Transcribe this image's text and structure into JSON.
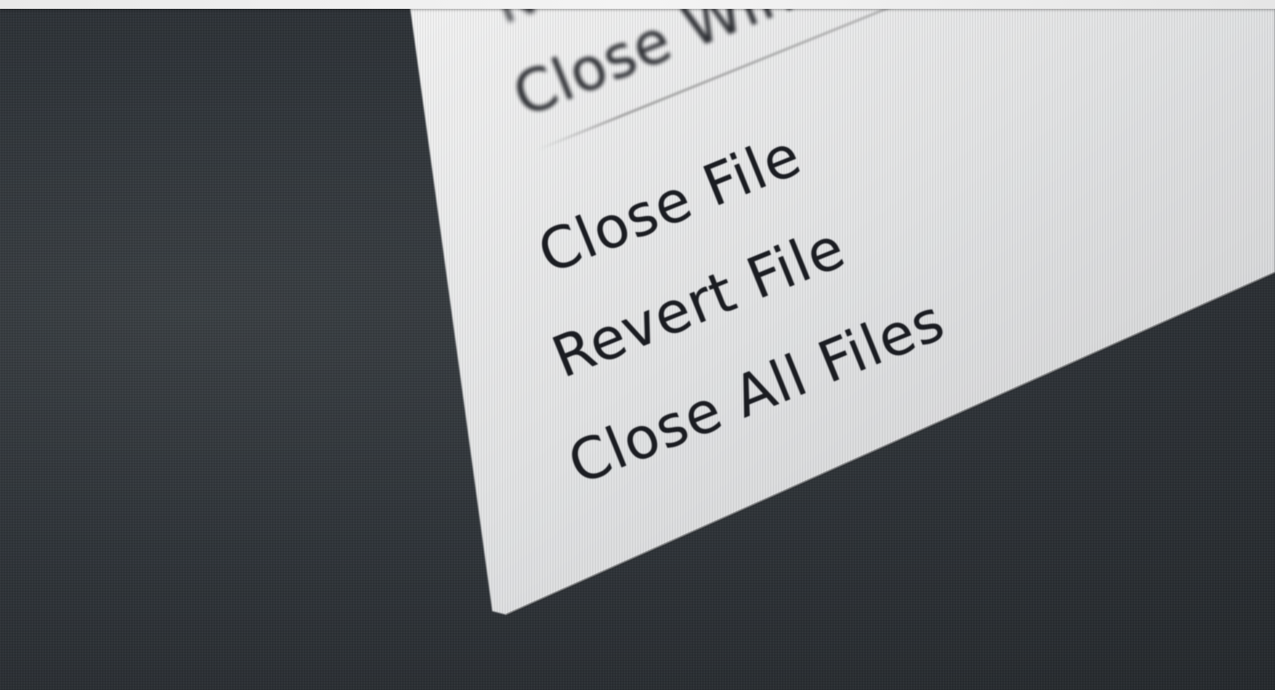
{
  "menu": {
    "partial_top_label": "N",
    "close_window_label": "Close Windo",
    "close_file_label": "Close File",
    "revert_file_label": "Revert File",
    "close_all_files_label": "Close All Files"
  },
  "colors": {
    "background": "#2f3336",
    "menu_surface": "#e4e5e6",
    "text": "#1b1d22"
  }
}
